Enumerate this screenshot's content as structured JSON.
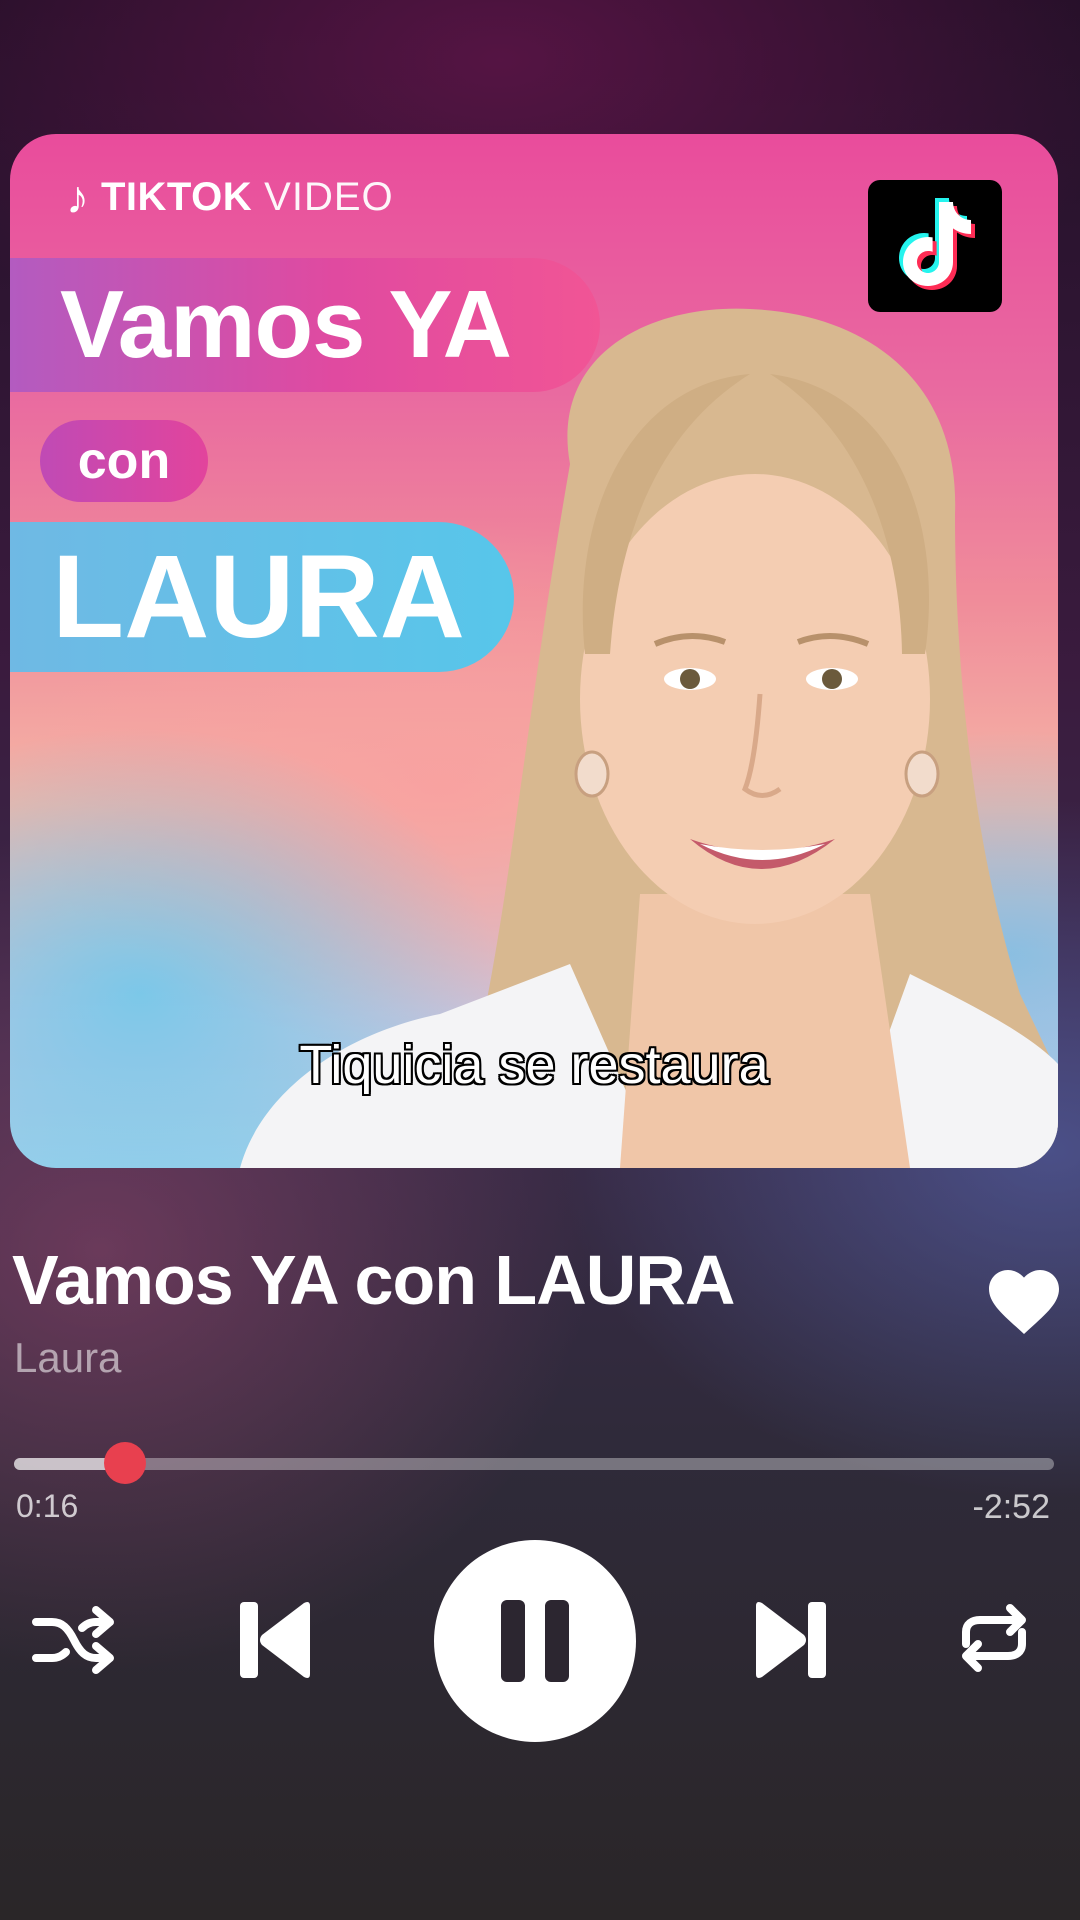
{
  "cover": {
    "brand_note": "♪",
    "brand_name": "TIKTOK",
    "brand_suffix": "VIDEO",
    "headline_1": "Vamos YA",
    "headline_2": "con",
    "headline_3": "LAURA",
    "caption": "Tiquicia se restaura"
  },
  "track": {
    "title": "Vamos YA con LAURA",
    "artist": "Laura",
    "liked": true
  },
  "playback": {
    "elapsed": "0:16",
    "remaining": "-2:52",
    "progress_fraction": 0.107,
    "state": "playing"
  },
  "icons": {
    "like": "heart-icon",
    "shuffle": "shuffle-icon",
    "previous": "skip-previous-icon",
    "pause": "pause-icon",
    "next": "skip-next-icon",
    "repeat": "repeat-icon",
    "app": "tiktok-logo-icon"
  },
  "colors": {
    "progress_thumb": "#e8404f",
    "headline_pink": "#e04aa0",
    "headline_blue": "#57c6ea"
  }
}
